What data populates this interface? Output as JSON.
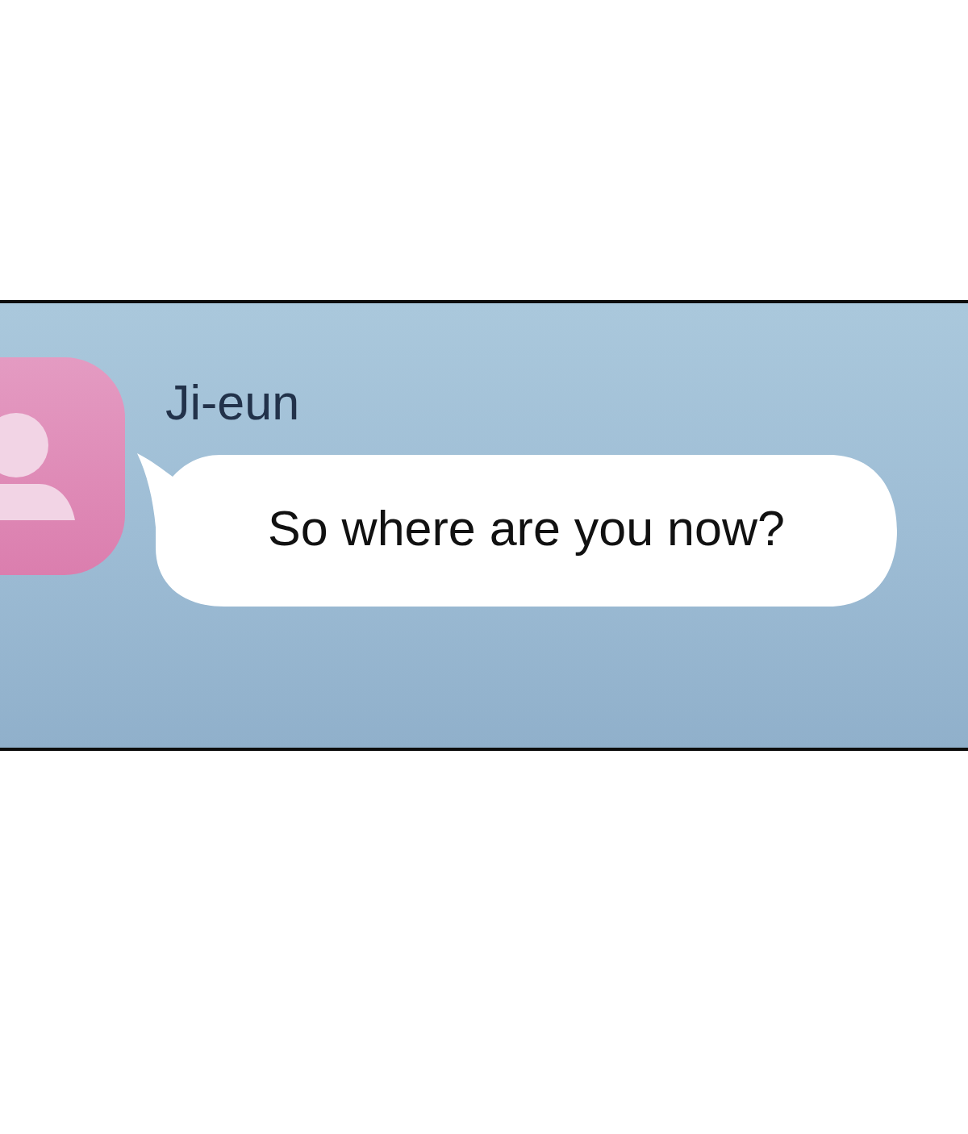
{
  "chat": {
    "sender": "Ji-eun",
    "message": "So where are you now?"
  }
}
